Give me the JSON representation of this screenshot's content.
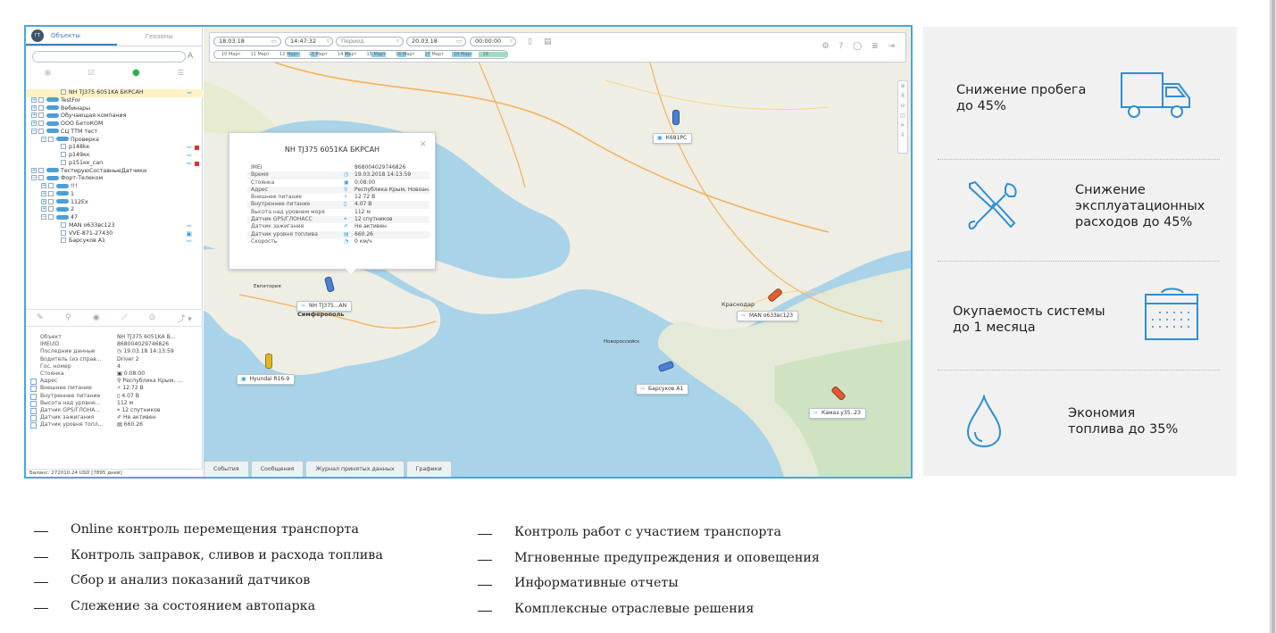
{
  "panel": {
    "tab_objects": "Объекты",
    "tab_geozones": "Геозоны",
    "logo": "ГТ",
    "search_letter": "A",
    "tree": [
      {
        "label": "NH TJ375 6051KA БКРСАН",
        "indent": 3,
        "expander": "",
        "pill": false,
        "selected": true,
        "action": "⇨",
        "red": false
      },
      {
        "label": "TestFor",
        "indent": 0,
        "expander": "+",
        "pill": true,
        "selected": false,
        "action": "",
        "red": false
      },
      {
        "label": "Вебинары",
        "indent": 0,
        "expander": "+",
        "pill": true,
        "selected": false,
        "action": "",
        "red": false
      },
      {
        "label": "Обучающая компания",
        "indent": 0,
        "expander": "+",
        "pill": true,
        "selected": false,
        "action": "",
        "red": false
      },
      {
        "label": "ООО БетоКОМ",
        "indent": 0,
        "expander": "+",
        "pill": true,
        "selected": false,
        "action": "",
        "red": false
      },
      {
        "label": "СЦ ТТМ тест",
        "indent": 0,
        "expander": "−",
        "pill": true,
        "selected": false,
        "action": "",
        "red": false
      },
      {
        "label": "Проверка",
        "indent": 1,
        "expander": "−",
        "pill": true,
        "selected": false,
        "action": "",
        "red": false
      },
      {
        "label": "p148kк",
        "indent": 3,
        "expander": "",
        "pill": false,
        "selected": false,
        "action": "⇨",
        "red": true
      },
      {
        "label": "p149кк",
        "indent": 3,
        "expander": "",
        "pill": false,
        "selected": false,
        "action": "⇨",
        "red": false
      },
      {
        "label": "p151кк_can",
        "indent": 3,
        "expander": "",
        "pill": false,
        "selected": false,
        "action": "⇨",
        "red": true
      },
      {
        "label": "ТестируюСоставныеДатчики",
        "indent": 0,
        "expander": "+",
        "pill": true,
        "selected": false,
        "action": "",
        "red": false
      },
      {
        "label": "Форт-Телеком",
        "indent": 0,
        "expander": "−",
        "pill": true,
        "selected": false,
        "action": "",
        "red": false
      },
      {
        "label": "!!!",
        "indent": 1,
        "expander": "+",
        "pill": true,
        "selected": false,
        "action": "",
        "red": false
      },
      {
        "label": "1",
        "indent": 1,
        "expander": "+",
        "pill": true,
        "selected": false,
        "action": "",
        "red": false
      },
      {
        "label": "112Ех",
        "indent": 1,
        "expander": "+",
        "pill": true,
        "selected": false,
        "action": "",
        "red": false
      },
      {
        "label": "2",
        "indent": 1,
        "expander": "+",
        "pill": true,
        "selected": false,
        "action": "",
        "red": false
      },
      {
        "label": "47",
        "indent": 1,
        "expander": "−",
        "pill": true,
        "selected": false,
        "action": "",
        "red": false
      },
      {
        "label": "MAN o633вс123",
        "indent": 3,
        "expander": "",
        "pill": false,
        "selected": false,
        "action": "⇨",
        "red": false
      },
      {
        "label": "VVE-871-27430",
        "indent": 3,
        "expander": "",
        "pill": false,
        "selected": false,
        "action": "▣",
        "red": false
      },
      {
        "label": "Барсуков А1",
        "indent": 3,
        "expander": "",
        "pill": false,
        "selected": false,
        "action": "⇨",
        "red": false
      }
    ],
    "tools2": [
      "✎",
      "⚲",
      "◉",
      "⟋",
      "⊙",
      "⤴ ▾"
    ],
    "props": [
      {
        "k": "Объект",
        "v": "NH TJ375 6051KA B...",
        "cb": false
      },
      {
        "k": "IMEI/ID",
        "v": "868004029746826",
        "cb": false
      },
      {
        "k": "Последние данные",
        "v": "◷ 19.03.18 14:13:59",
        "cb": false
      },
      {
        "k": "Водитель (из справ...",
        "v": "Driver 2",
        "cb": false
      },
      {
        "k": "Гос. номер",
        "v": "4",
        "cb": false
      },
      {
        "k": "Стоянка",
        "v": "▣ 0:08:00",
        "cb": false
      },
      {
        "k": "Адрес",
        "v": "⚲ Республика Крым, ...",
        "cb": true
      },
      {
        "k": "Внешнее питание",
        "v": "⚡ 12.72 В",
        "cb": true
      },
      {
        "k": "Внутреннее питание",
        "v": "▯ 4.07 В",
        "cb": true
      },
      {
        "k": "Высота над уровне...",
        "v": "112 м",
        "cb": true
      },
      {
        "k": "Датчик GPS/ГЛОНА...",
        "v": "⌖ 12 спутников",
        "cb": true
      },
      {
        "k": "Датчик зажигания",
        "v": "✐ Не активен",
        "cb": true
      },
      {
        "k": "Датчик уровня топл...",
        "v": "▤ 660.26",
        "cb": true
      }
    ],
    "balance": "Баланс: 272010.24 USD [7895 дней]"
  },
  "toolbar": {
    "date_from": "18.03.18",
    "time_from": "14:47:32",
    "period_placeholder": "Период",
    "date_to": "20.03.18",
    "time_to": "00:00:00",
    "timeline": [
      "10 Март",
      "11 Март",
      "12 Март",
      "13 Март",
      "14 Март",
      "15 Март",
      "16 Март",
      "17 Март",
      "18 Март",
      "19"
    ],
    "right_icons": "⚙ ? ◯ ≣ ⇥"
  },
  "map_side": [
    "⊕",
    "8",
    "⊖",
    "◫",
    "⊳",
    "⊽"
  ],
  "popup": {
    "title": "NH TJ375 6051KA БКРСАН",
    "close": "×",
    "rows": [
      {
        "k": "IMEI",
        "ic": "",
        "v": "868004029746826"
      },
      {
        "k": "Время",
        "ic": "◷",
        "v": "19.03.2018 14:13:59"
      },
      {
        "k": "Стоянка",
        "ic": "▣",
        "v": "0:08:00"
      },
      {
        "k": "Адрес",
        "ic": "⚲",
        "v": "Республика Крым, Новоан..."
      },
      {
        "k": "Внешнее питание",
        "ic": "⚡",
        "v": "12.72 В"
      },
      {
        "k": "Внутреннее питание",
        "ic": "▯",
        "v": "4.07 В"
      },
      {
        "k": "Высота над уровнем моря",
        "ic": "",
        "v": "112 м"
      },
      {
        "k": "Датчик GPS/ГЛОНАСС",
        "ic": "⌖",
        "v": "12 спутников"
      },
      {
        "k": "Датчик зажигания",
        "ic": "✐",
        "v": "Не активен"
      },
      {
        "k": "Датчик уровня топлива",
        "ic": "▤",
        "v": "660.26"
      },
      {
        "k": "Скорость",
        "ic": "◔",
        "v": "0 км/ч"
      }
    ]
  },
  "vehicles": {
    "k681": "К681РС",
    "nh": "NH TJ375...AN",
    "man": "MAN o633вс123",
    "barsukov": "Барсуков А1",
    "hyundai": "Hyundai R16-9",
    "kamaz": "Камаз у35..23"
  },
  "cities": {
    "simferopol": "Симферополь",
    "krasnodar": "Краснодар",
    "evpatoria": "Евпатория",
    "novorossiysk": "Новороссийск"
  },
  "bottom_tabs": [
    "События",
    "Сообщения",
    "Журнал принятых данных",
    "Графики"
  ],
  "benefits": [
    {
      "text": "Снижение пробега\nдо 45%",
      "icon": "truck-icon"
    },
    {
      "text": "Снижение\nэксплуатационных\nрасходов до 45%",
      "icon": "tools-icon"
    },
    {
      "text": "Окупаемость системы\nдо 1 месяца",
      "icon": "calendar-icon"
    },
    {
      "text": "Экономия\nтоплива до 35%",
      "icon": "drop-icon"
    }
  ],
  "features_left": [
    "Online контроль перемещения транспорта",
    "Контроль заправок, сливов и расхода топлива",
    "Сбор и анализ показаний датчиков",
    "Слежение за состоянием автопарка"
  ],
  "features_right": [
    "Контроль работ с участием транспорта",
    "Мгновенные предупреждения и оповещения",
    "Информативные отчеты",
    "Комплексные отраслевые решения"
  ],
  "colors": {
    "accent": "#3aa0e0",
    "frame": "#4aa8d8",
    "icon_blue": "#2f8fd1"
  }
}
